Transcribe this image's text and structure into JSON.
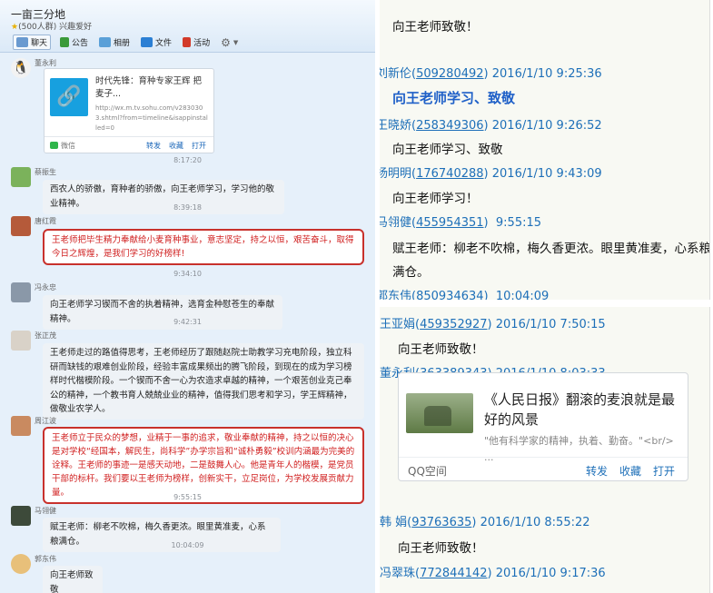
{
  "left": {
    "group_name": "一亩三分地",
    "group_sub": "(500人群) 兴趣爱好",
    "toolbar": [
      "聊天",
      "公告",
      "相册",
      "文件",
      "活动"
    ],
    "messages": [
      {
        "name": "董永利",
        "card": {
          "title": "时代先锋：育种专家王辉 把麦子...",
          "url": "http://wx.m.tv.sohu.com/v2830303.shtml?from=timeline&isappinstalled=0",
          "source": "微信",
          "actions": [
            "转发",
            "收藏",
            "打开"
          ]
        }
      },
      {
        "time": "8:17:20"
      },
      {
        "name": "蔡振生",
        "text": "西农人的骄傲，育种者的骄傲，向王老师学习，学习他的敬业精神。"
      },
      {
        "time": "8:39:18"
      },
      {
        "name": "唐红霞",
        "text": "王老师把毕生精力奉献给小麦育种事业，意志坚定，持之以恒，艰苦奋斗，取得今日之辉煌，是我们学习的好榜样!",
        "highlight": true
      },
      {
        "time": "9:34:10"
      },
      {
        "name": "冯永忠",
        "text": "向王老师学习锲而不舍的执着精神，选育金种慰苍生的奉献精神。"
      },
      {
        "time": "9:42:31"
      },
      {
        "name": "张正茂",
        "text": "王老师走过的路值得思考，王老师经历了跟随赵院士助教学习充电阶段，独立科研而缺钱的艰难创业阶段，经验丰富成果频出的腾飞阶段，到现在的成为学习榜样时代楷模阶段。一个锲而不舍一心为农造求卓越的精神，一个艰苦创业克己奉公的精神，一个教书育人兢兢业业的精神，值得我们思考和学习，学王辉精神，做敬业农学人。"
      },
      {
        "name": "周江波",
        "text": "王老师立于民众的梦想，业精于一事的追求，敬业奉献的精神，持之以恒的决心是对学校“经国本，解民生，尚科学”办学宗旨和“诚朴勇毅”校训内涵最为完美的诠释。王老师的事迹一是感天动地，二是鼓舞人心。他是青年人的楷模，是党员干部的标杆。我们要以王老师为榜样，创新实干，立足岗位，为学校发展贡献力量。",
        "highlight": true
      },
      {
        "time": "9:55:15"
      },
      {
        "name": "马翎健",
        "text": "赋王老师：柳老不吹棉，梅久香更浓。眼里黄准麦，心系粮满仓。"
      },
      {
        "time": "10:04:09"
      },
      {
        "name": "郭东伟",
        "text": "向王老师致敬"
      }
    ]
  },
  "right_top": [
    {
      "type": "body",
      "text": "向王老师致敬！"
    },
    {
      "type": "head",
      "name": "刘新伦",
      "qq": "509280492",
      "datetime": "2016/1/10 9:25:36"
    },
    {
      "type": "body",
      "text": "向王老师学习、致敬",
      "big": true
    },
    {
      "type": "head",
      "name": "王晓娇",
      "qq": "258349306",
      "datetime": "2016/1/10 9:26:52"
    },
    {
      "type": "body",
      "text": "向王老师学习、致敬"
    },
    {
      "type": "head",
      "name": "杨明明",
      "qq": "176740288",
      "datetime": "2016/1/10 9:43:09"
    },
    {
      "type": "body",
      "text": "向王老师学习！"
    },
    {
      "type": "head",
      "name": "马翎健",
      "qq": "455954351",
      "datetime": "9:55:15"
    },
    {
      "type": "body",
      "text": "赋王老师：柳老不吹棉，梅久香更浓。眼里黄准麦，心系粮"
    },
    {
      "type": "body",
      "text": "满仓。"
    },
    {
      "type": "head",
      "name": "郭东伟",
      "qq": "850934634",
      "datetime": "10:04:09"
    }
  ],
  "right_bottom": [
    {
      "type": "head",
      "name": "王亚娟",
      "qq": "459352927",
      "datetime": "2016/1/10 7:50:15"
    },
    {
      "type": "body",
      "text": "向王老师致敬！"
    },
    {
      "type": "head",
      "name": "董永利",
      "qq": "363389343",
      "datetime": "2016/1/10 8:03:33"
    },
    {
      "type": "head",
      "name": "韩  娟",
      "qq": "93763635",
      "datetime": "2016/1/10 8:55:22"
    },
    {
      "type": "body",
      "text": "向王老师致敬！"
    },
    {
      "type": "head",
      "name": "冯翠珠",
      "qq": "772844142",
      "datetime": "2016/1/10 9:17:36"
    }
  ],
  "qq_card": {
    "title": "《人民日报》翻滚的麦浪就是最好的风景",
    "desc": "\"他有科学家的精神，执着、勤奋。\"<br/>    ...",
    "source": "QQ空间",
    "actions": [
      "转发",
      "收藏",
      "打开"
    ]
  },
  "colors": {
    "link": "#1d6fb8",
    "highlight_border": "#c8312c",
    "highlight_text": "#d02020"
  }
}
